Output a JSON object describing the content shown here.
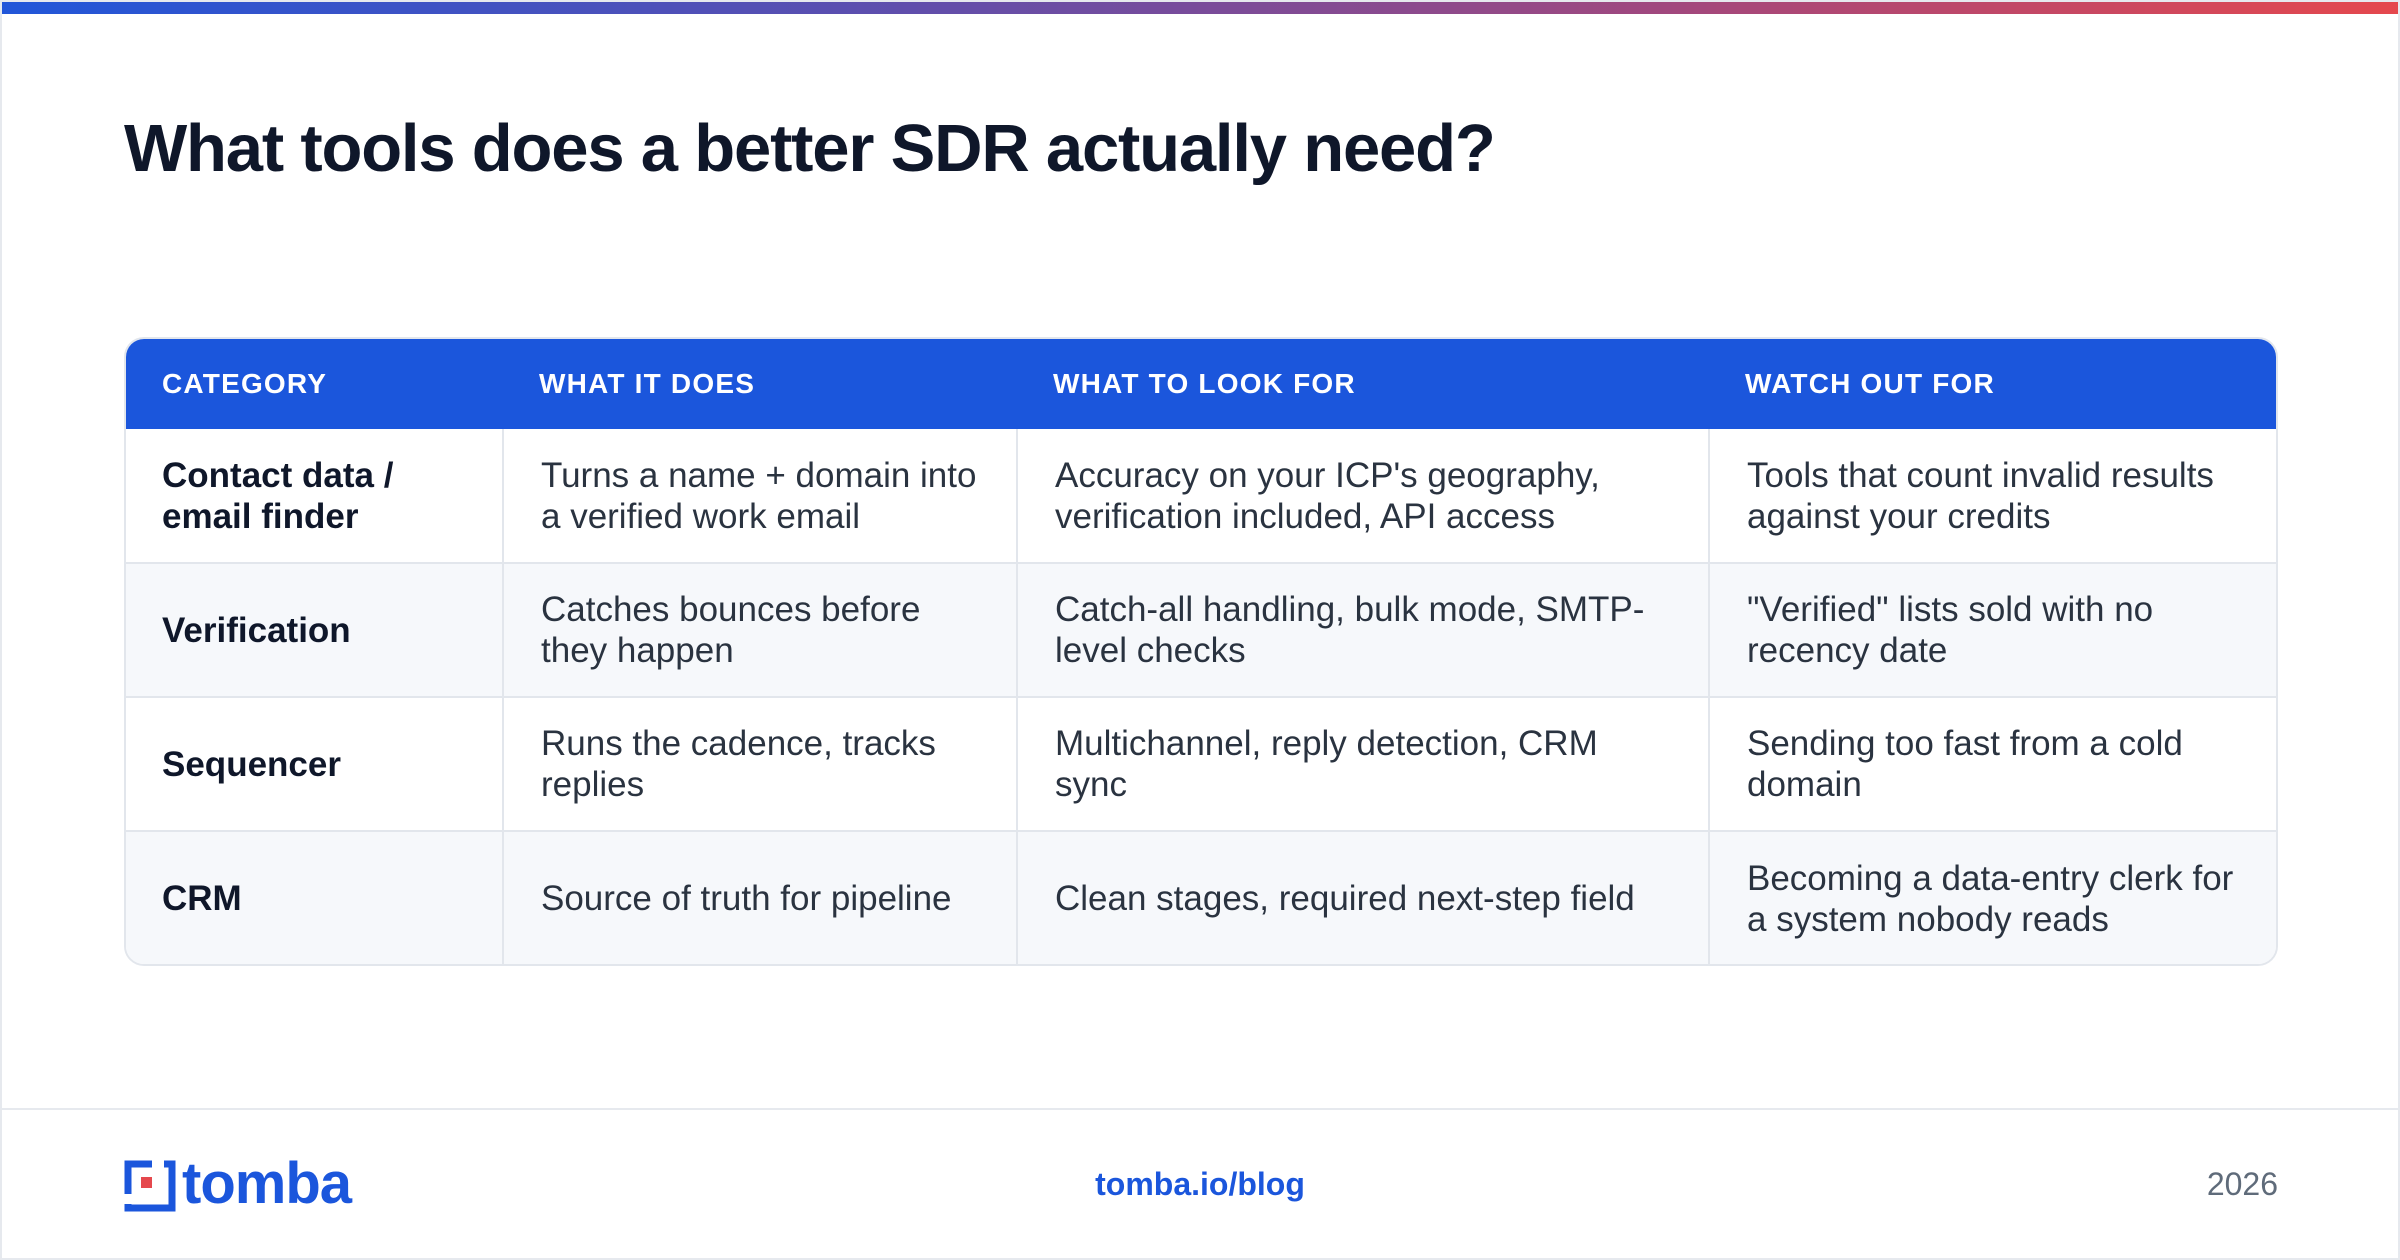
{
  "title": "What tools does a better SDR actually need?",
  "brand": {
    "accent": "#1b56dc",
    "gradient": [
      "#2156d9",
      "#e5484d"
    ],
    "logo_text": "tomba"
  },
  "table": {
    "headers": [
      "CATEGORY",
      "WHAT IT DOES",
      "WHAT TO LOOK FOR",
      "WATCH OUT FOR"
    ],
    "rows": [
      [
        "Contact data / email finder",
        "Turns a name + domain into a verified work email",
        "Accuracy on your ICP's geography, verification included, API access",
        "Tools that count invalid results against your credits"
      ],
      [
        "Verification",
        "Catches bounces before they happen",
        "Catch-all handling, bulk mode, SMTP-level checks",
        "\"Verified\" lists sold with no recency date"
      ],
      [
        "Sequencer",
        "Runs the cadence, tracks replies",
        "Multichannel, reply detection, CRM sync",
        "Sending too fast from a cold domain"
      ],
      [
        "CRM",
        "Source of truth for pipeline",
        "Clean stages, required next-step field",
        "Becoming a data-entry clerk for a system nobody reads"
      ]
    ]
  },
  "footer": {
    "link": "tomba.io/blog",
    "year": "2026"
  }
}
